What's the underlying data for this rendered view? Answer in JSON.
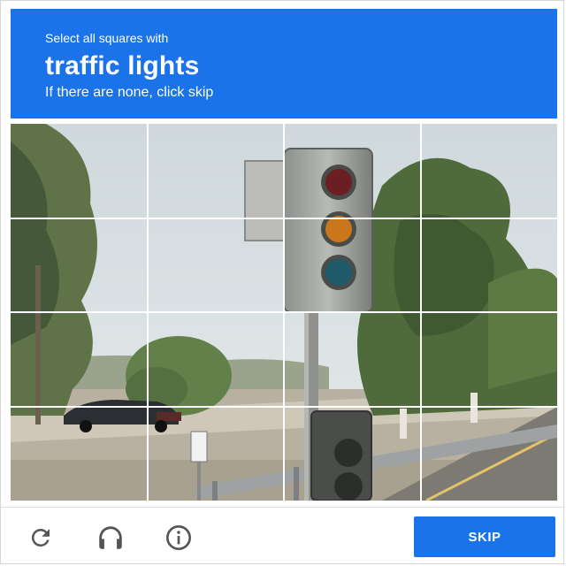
{
  "challenge": {
    "instruction": "Select all squares with",
    "target": "traffic lights",
    "hint": "If there are none, click skip"
  },
  "grid": {
    "rows": 4,
    "columns": 4
  },
  "footer": {
    "icons": [
      "reload-icon",
      "headphones-icon",
      "info-icon"
    ],
    "skip_label": "SKIP"
  },
  "colors": {
    "accent": "#1a73e8",
    "header_text": "#ffffff",
    "icon": "#555555"
  }
}
